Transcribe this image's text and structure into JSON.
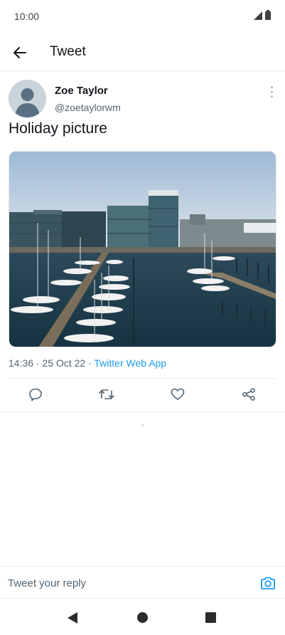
{
  "status_bar": {
    "time": "10:00"
  },
  "header": {
    "title": "Tweet"
  },
  "tweet": {
    "author_name": "Zoe Taylor",
    "author_handle": "@zoetaylorwm",
    "text": "Holiday picture",
    "time": "14:36",
    "separator": " · ",
    "date": "25 Oct 22",
    "source": "Twitter Web App"
  },
  "reply": {
    "placeholder": "Tweet your reply"
  },
  "icons": {
    "back": "arrow-left-icon",
    "more": "more-vertical-icon",
    "reply": "comment-icon",
    "retweet": "retweet-icon",
    "like": "heart-icon",
    "share": "share-icon",
    "camera": "camera-icon"
  },
  "colors": {
    "accent": "#1d9bf0",
    "muted": "#536471",
    "text": "#0f1419"
  }
}
